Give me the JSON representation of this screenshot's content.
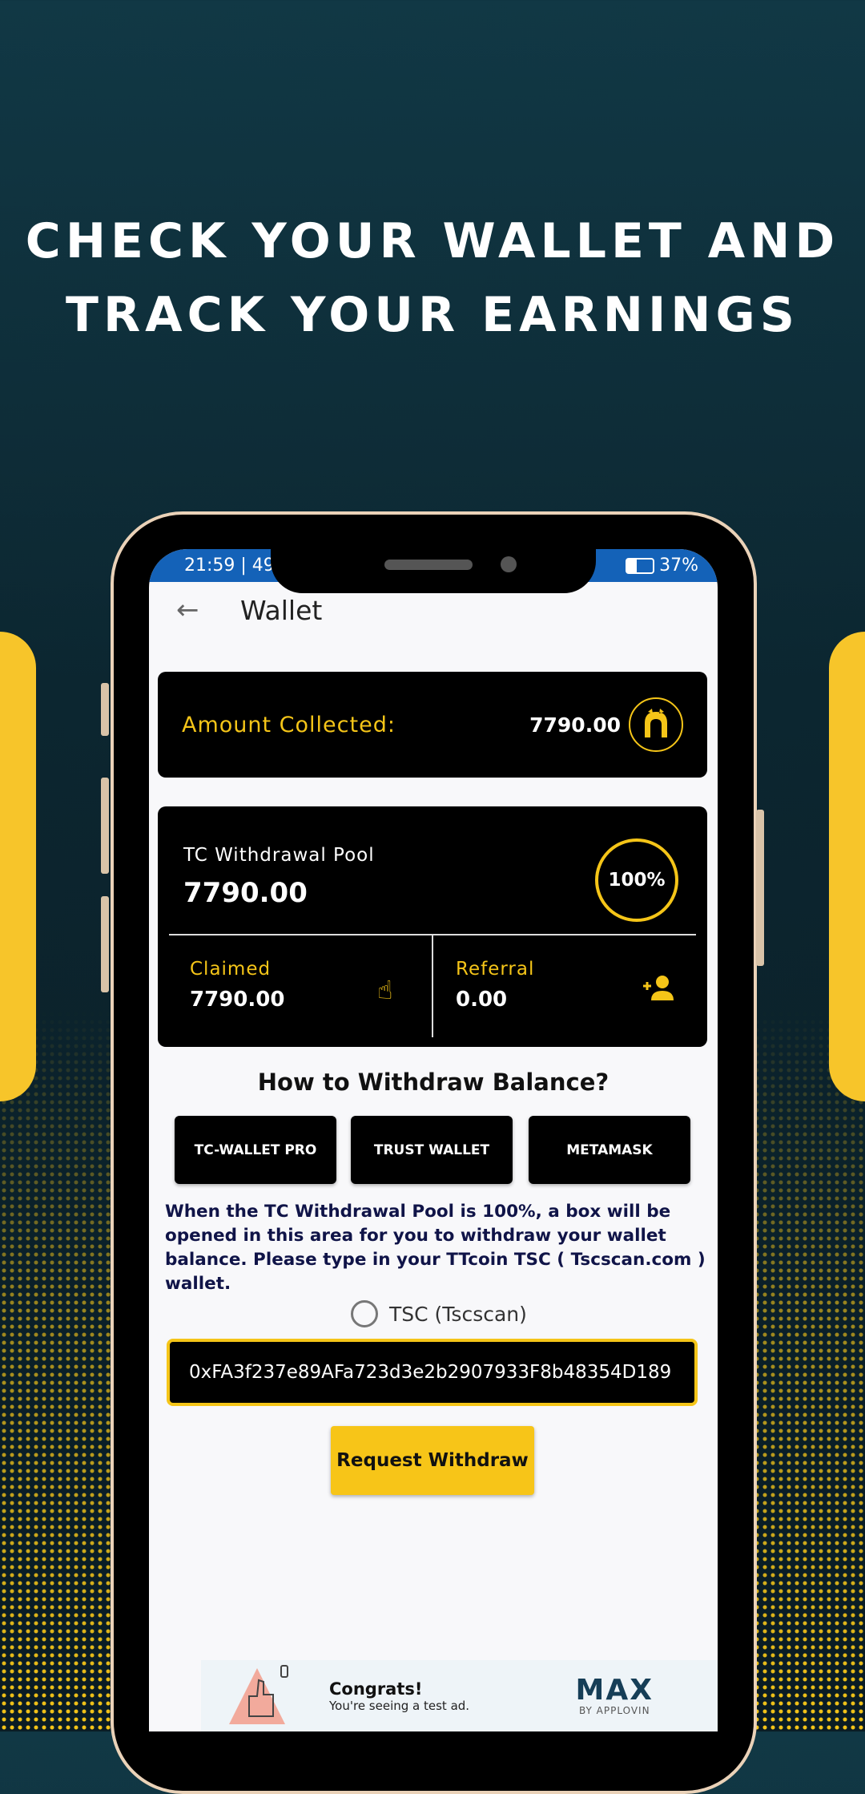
{
  "headline": {
    "line1": "CHECK YOUR WALLET AND",
    "line2": "TRACK YOUR EARNINGS"
  },
  "status_bar": {
    "time": "21:59 | 49",
    "battery": "37%"
  },
  "app_bar": {
    "title": "Wallet",
    "back_icon": "arrow-left-icon"
  },
  "amount_card": {
    "label": "Amount Collected:",
    "value": "7790.00",
    "icon": "coin-logo-icon"
  },
  "pool_card": {
    "label": "TC Withdrawal Pool",
    "value": "7790.00",
    "progress_label": "100%",
    "progress": 100,
    "claimed": {
      "label": "Claimed",
      "value": "7790.00",
      "icon": "tap-hand-icon"
    },
    "referral": {
      "label": "Referral",
      "value": "0.00",
      "icon": "person-add-icon"
    }
  },
  "withdraw": {
    "heading": "How to Withdraw Balance?",
    "buttons": [
      "TC-WALLET PRO",
      "TRUST WALLET",
      "METAMASK"
    ],
    "info": "When the TC Withdrawal Pool is 100%, a box will be opened in this area for you to withdraw your wallet balance. Please type in your TTcoin TSC ( Tscscan.com ) wallet.",
    "radio_label": "TSC (Tscscan)",
    "address": "0xFA3f237e89AFa723d3e2b2907933F8b48354D189",
    "request_label": "Request Withdraw"
  },
  "ad": {
    "title": "Congrats!",
    "subtitle": "You're seeing a test ad.",
    "brand": "MAX",
    "brand_sub": "BY APPLOVIN"
  },
  "colors": {
    "accent": "#f5c518",
    "status_bar": "#1462b8",
    "background": "#0c2630"
  }
}
